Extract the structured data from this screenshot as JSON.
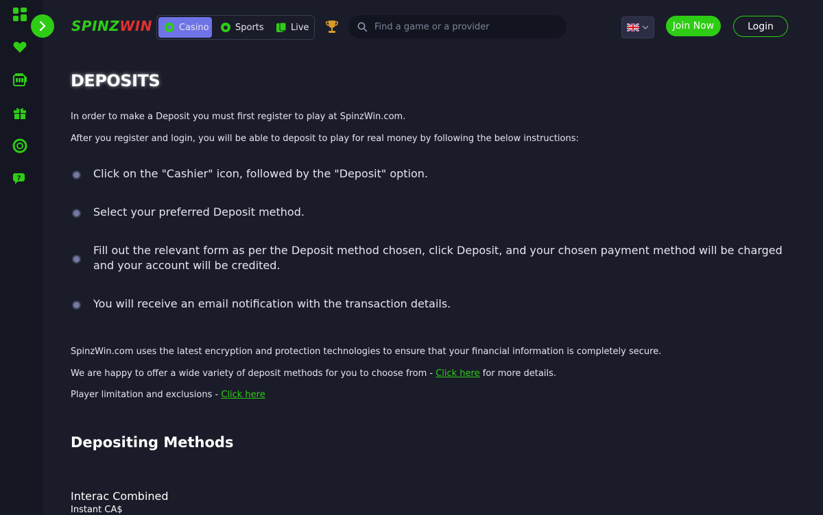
{
  "sidebar": {
    "icons": [
      "grid-icon",
      "heart-icon",
      "slot-machine-icon",
      "gift-icon",
      "lifebuoy-icon",
      "chat-support-icon"
    ]
  },
  "header": {
    "logo_part1": "SPINZ",
    "logo_part2": "WIN",
    "tabs": [
      {
        "label": "Casino",
        "icon": "casino-chip-icon",
        "active": true
      },
      {
        "label": "Sports",
        "icon": "soccer-ball-icon",
        "active": false
      },
      {
        "label": "Live",
        "icon": "live-cards-icon",
        "active": false
      }
    ],
    "search_placeholder": "Find a game or a provider",
    "language_flag": "uk-flag-icon",
    "join_label": "Join Now",
    "login_label": "Login"
  },
  "main": {
    "title": "DEPOSITS",
    "intro1": "In order to make a Deposit you must first register to play at SpinzWin.com.",
    "intro2": "After you register and login, you will be able to deposit to play for real money by following the below instructions:",
    "steps": [
      "Click on the \"Cashier\" icon, followed by the \"Deposit\" option.",
      "Select your preferred Deposit method.",
      "Fill out the relevant form as per the Deposit method chosen, click Deposit, and your chosen payment method will be charged and your account will be credited.",
      "You will receive an email notification with the transaction details."
    ],
    "security_text": "SpinzWin.com uses the latest encryption and protection technologies to ensure that your financial information is completely secure.",
    "methods_prefix": "We are happy to offer a wide variety of deposit methods for you to choose from - ",
    "methods_link": "Click here",
    "methods_suffix": " for more details.",
    "limits_prefix": "Player limitation and exclusions - ",
    "limits_link": "Click here",
    "section_title": "Depositing Methods",
    "method_name": "Interac Combined",
    "method_sub": "Instant CA$"
  },
  "colors": {
    "accent_green": "#2ecc15",
    "active_tab": "#6f73e8",
    "background": "#1a1c29",
    "sidebar": "#141621"
  }
}
